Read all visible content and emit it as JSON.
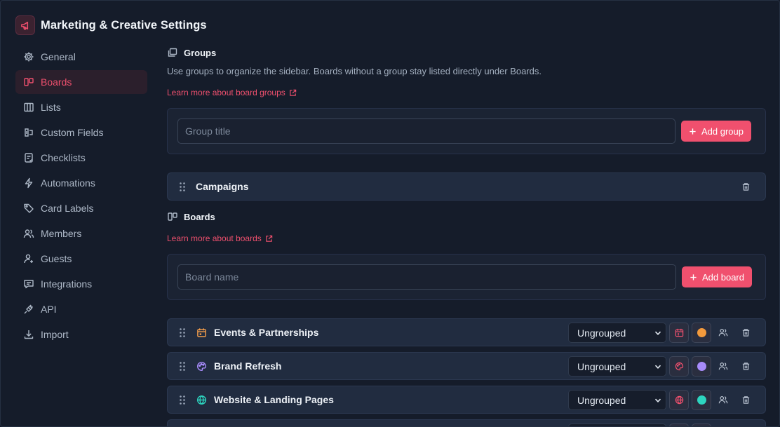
{
  "header": {
    "title": "Marketing & Creative Settings",
    "logo_icon": "megaphone-icon"
  },
  "sidebar": {
    "items": [
      {
        "label": "General",
        "icon": "gear-icon",
        "active": false
      },
      {
        "label": "Boards",
        "icon": "boards-icon",
        "active": true
      },
      {
        "label": "Lists",
        "icon": "columns-icon",
        "active": false
      },
      {
        "label": "Custom Fields",
        "icon": "custom-fields-icon",
        "active": false
      },
      {
        "label": "Checklists",
        "icon": "checklist-icon",
        "active": false
      },
      {
        "label": "Automations",
        "icon": "lightning-icon",
        "active": false
      },
      {
        "label": "Card Labels",
        "icon": "tag-icon",
        "active": false
      },
      {
        "label": "Members",
        "icon": "users-icon",
        "active": false
      },
      {
        "label": "Guests",
        "icon": "user-plus-icon",
        "active": false
      },
      {
        "label": "Integrations",
        "icon": "chat-icon",
        "active": false
      },
      {
        "label": "API",
        "icon": "plug-icon",
        "active": false
      },
      {
        "label": "Import",
        "icon": "download-icon",
        "active": false
      }
    ]
  },
  "groups": {
    "heading": "Groups",
    "description": "Use groups to organize the sidebar. Boards without a group stay listed directly under Boards.",
    "learn_more": "Learn more about board groups",
    "input_placeholder": "Group title",
    "add_label": "Add group",
    "items": [
      {
        "name": "Campaigns"
      }
    ]
  },
  "boards": {
    "heading": "Boards",
    "learn_more": "Learn more about boards",
    "input_placeholder": "Board name",
    "add_label": "Add board",
    "items": [
      {
        "name": "Events & Partnerships",
        "icon": "calendar-icon",
        "icon_color": "#f59e4b",
        "group": "Ungrouped",
        "color": "#f39a3c"
      },
      {
        "name": "Brand Refresh",
        "icon": "palette-icon",
        "icon_color": "#a78bfa",
        "group": "Ungrouped",
        "color": "#a78bfa"
      },
      {
        "name": "Website & Landing Pages",
        "icon": "globe-icon",
        "icon_color": "#2dd4bf",
        "group": "Ungrouped",
        "color": "#2dd4bf"
      }
    ]
  },
  "colors": {
    "accent": "#f0506e",
    "background": "#151c2a",
    "card": "#1b2333",
    "row": "#212c40"
  }
}
